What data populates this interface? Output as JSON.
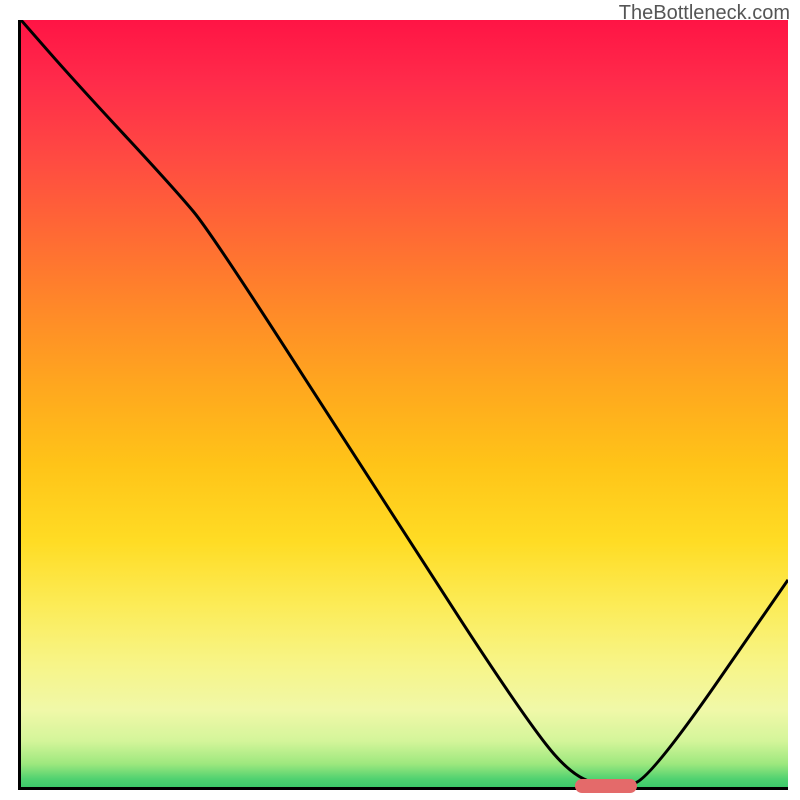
{
  "watermark": "TheBottleneck.com",
  "chart_data": {
    "type": "line",
    "title": "",
    "xlabel": "",
    "ylabel": "",
    "xlim": [
      0,
      100
    ],
    "ylim": [
      0,
      100
    ],
    "grid": false,
    "legend_position": "none",
    "series": [
      {
        "name": "bottleneck-curve",
        "x": [
          0,
          7,
          20,
          25,
          50,
          65,
          72,
          78,
          82,
          100
        ],
        "values": [
          100,
          92,
          78,
          72,
          33,
          10,
          1,
          0,
          1,
          27
        ]
      }
    ],
    "marker": {
      "x_start": 72,
      "x_end": 80,
      "y": 0.5,
      "color": "#e46a6a"
    },
    "gradient_stops": [
      {
        "pos": 0,
        "color": "#ff1445"
      },
      {
        "pos": 50,
        "color": "#ffb01a"
      },
      {
        "pos": 80,
        "color": "#fceb55"
      },
      {
        "pos": 100,
        "color": "#3cc96a"
      }
    ]
  }
}
